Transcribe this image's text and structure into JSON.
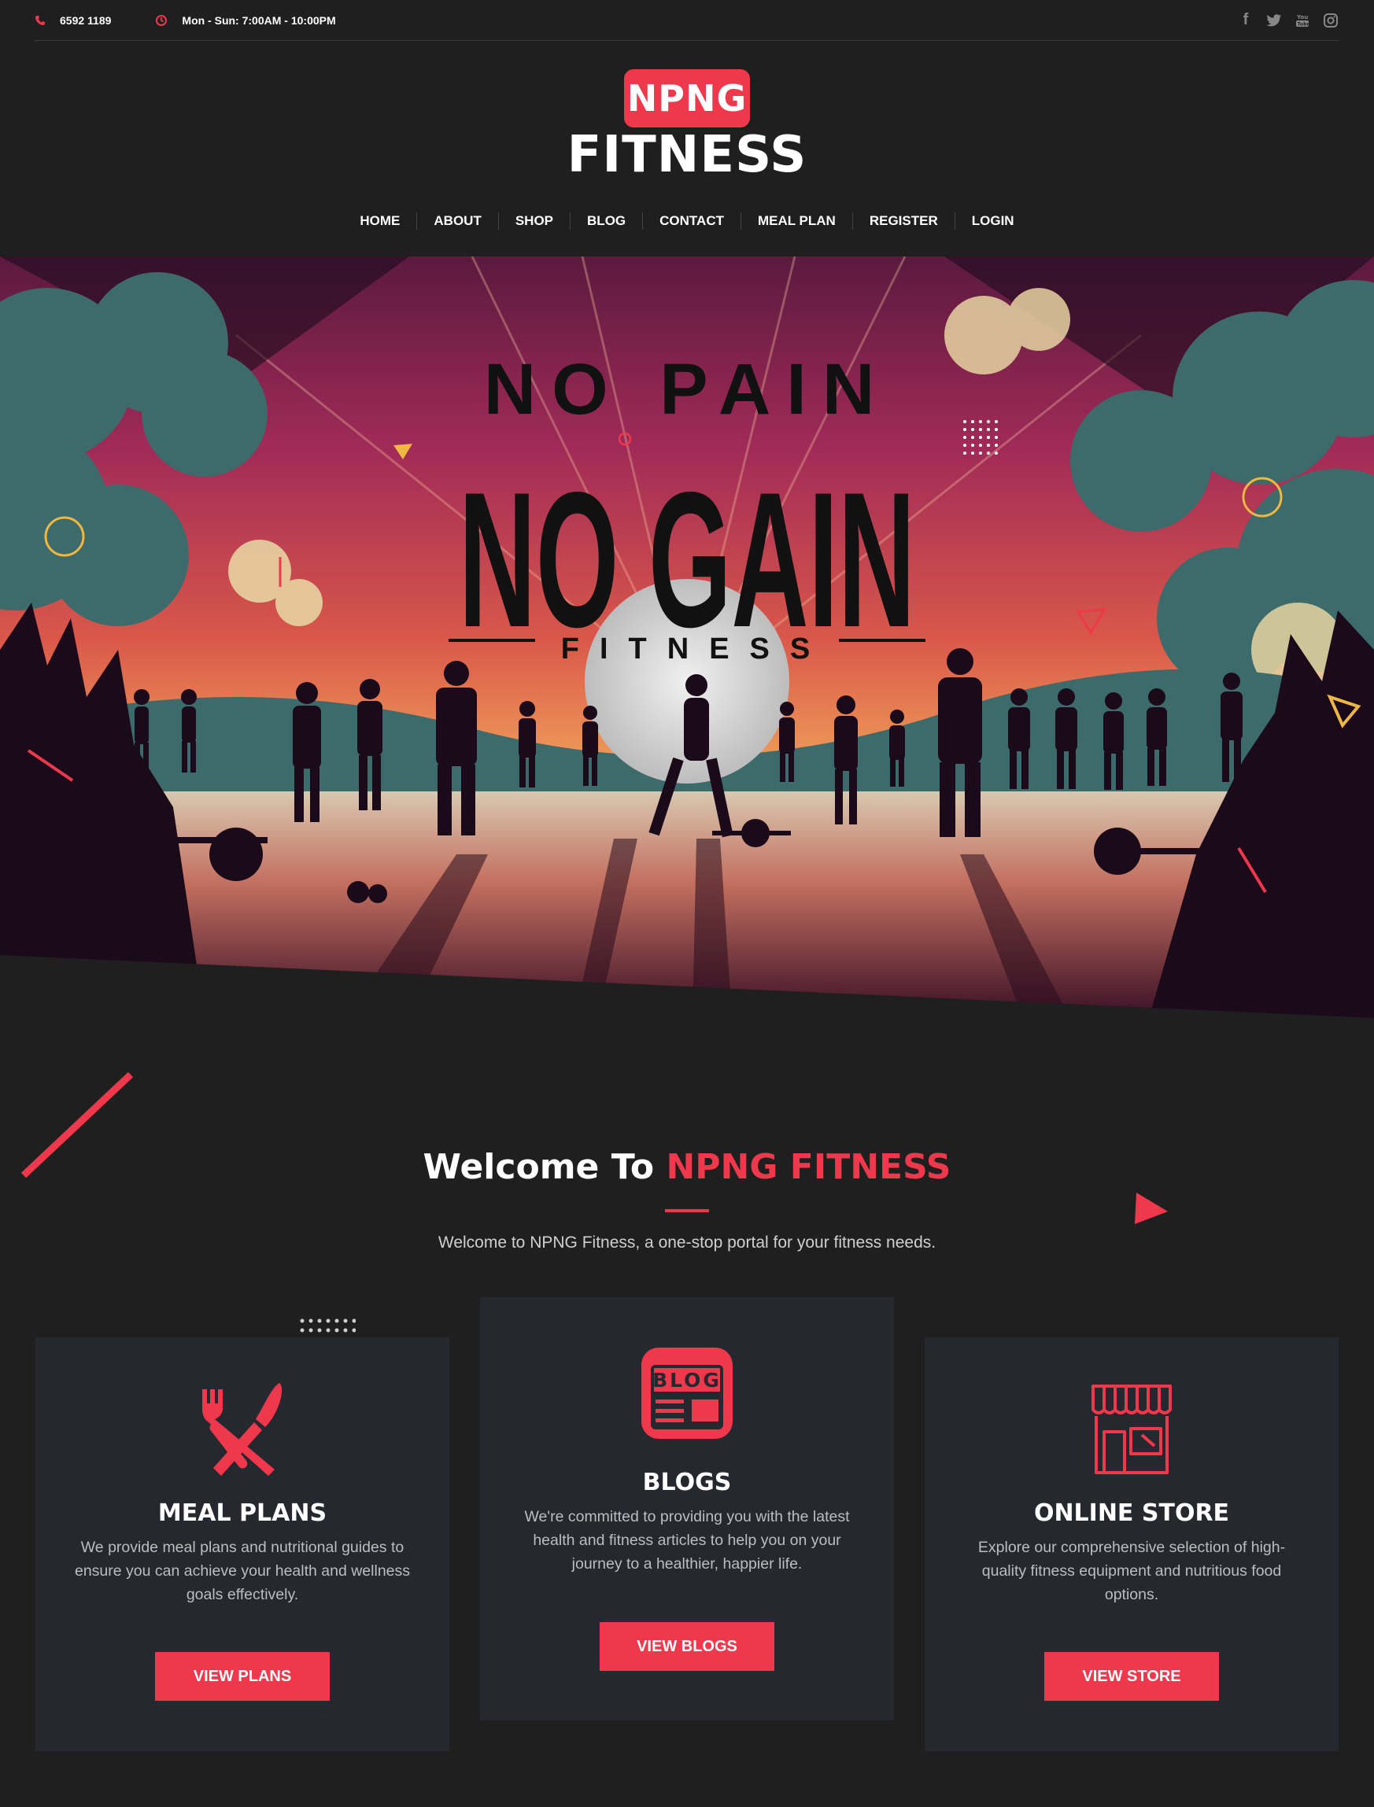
{
  "topbar": {
    "phone": "6592 1189",
    "hours": "Mon - Sun: 7:00AM - 10:00PM",
    "socials": [
      "facebook-icon",
      "twitter-icon",
      "youtube-icon",
      "instagram-icon"
    ]
  },
  "logo": {
    "badge": "NPNG",
    "word": "FITNESS"
  },
  "nav": [
    "HOME",
    "ABOUT",
    "SHOP",
    "BLOG",
    "CONTACT",
    "MEAL PLAN",
    "REGISTER",
    "LOGIN"
  ],
  "hero": {
    "line1": "NO PAIN",
    "line2": "NO GAIN",
    "line3": "FITNESS"
  },
  "welcome": {
    "title_prefix": "Welcome To ",
    "title_accent": "NPNG FITNESS",
    "subtitle": "Welcome to NPNG Fitness, a one-stop portal for your fitness needs."
  },
  "cards": [
    {
      "icon": "fork-knife-icon",
      "title": "MEAL PLANS",
      "text": "We provide meal plans and nutritional guides to ensure you can achieve your health and wellness goals effectively.",
      "button": "VIEW PLANS"
    },
    {
      "icon": "blog-icon",
      "icon_label": "BLOG",
      "title": "BLOGS",
      "text": "We're committed to providing you with the latest health and fitness articles to help you on your journey to a healthier, happier life.",
      "button": "VIEW BLOGS"
    },
    {
      "icon": "store-icon",
      "title": "ONLINE STORE",
      "text": "Explore our comprehensive selection of high-quality fitness equipment and nutritious food options.",
      "button": "VIEW STORE"
    }
  ],
  "colors": {
    "accent": "#f0384c",
    "background": "#1f1f1f",
    "card": "#262830"
  }
}
